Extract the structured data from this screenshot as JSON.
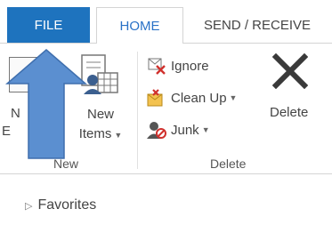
{
  "tabs": {
    "file": "FILE",
    "home": "HOME",
    "send_receive": "SEND / RECEIVE"
  },
  "ribbon": {
    "new_group": {
      "label": "New",
      "new_email_line1": "N",
      "new_email_line2": "E",
      "new_items_line1": "New",
      "new_items_line2": "Items"
    },
    "delete_group": {
      "label": "Delete",
      "ignore": "Ignore",
      "clean_up": "Clean Up",
      "junk": "Junk",
      "delete": "Delete"
    }
  },
  "nav": {
    "favorites": "Favorites"
  },
  "colors": {
    "file_tab": "#1e73be",
    "home_tab_text": "#2a72c7",
    "arrow": "#5b8fd0"
  },
  "icons": [
    "new-email-icon",
    "new-items-icon",
    "ignore-icon",
    "clean-up-icon",
    "junk-icon",
    "delete-icon",
    "arrow-up-annotation",
    "expand-triangle-icon"
  ]
}
